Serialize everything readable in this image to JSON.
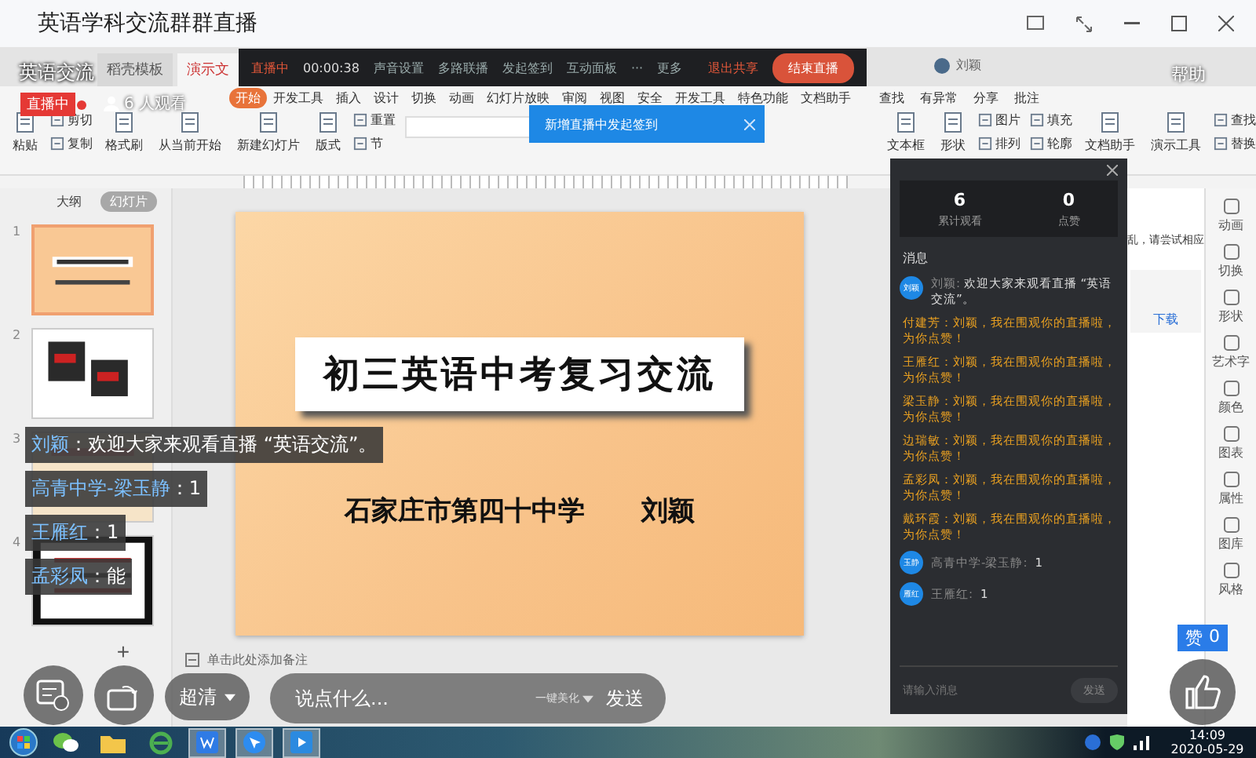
{
  "window": {
    "title": "英语学科交流群群直播"
  },
  "doc_tabs": [
    {
      "label": "稻壳模板",
      "selected": false
    },
    {
      "label": "演示文",
      "selected": true
    }
  ],
  "live_bar": {
    "status": "直播中",
    "timer": "00:00:38",
    "items": [
      "声音设置",
      "多路联播",
      "发起签到",
      "互动面板"
    ],
    "more_glyph": "···",
    "more": "更多",
    "exit_share": "退出共享",
    "end_live": "结束直播"
  },
  "account": {
    "name": "刘颖"
  },
  "help": "帮助",
  "stream_overlay": {
    "title": "英语交流",
    "badge": "直播中",
    "viewers": "6 人观看"
  },
  "menu": {
    "tabs": [
      {
        "label": "开始",
        "selected": true
      },
      {
        "label": "开发工具",
        "selected": false
      },
      {
        "label": "插入",
        "selected": false
      },
      {
        "label": "设计",
        "selected": false
      },
      {
        "label": "切换",
        "selected": false
      },
      {
        "label": "动画",
        "selected": false
      },
      {
        "label": "幻灯片放映",
        "selected": false
      },
      {
        "label": "审阅",
        "selected": false
      },
      {
        "label": "视图",
        "selected": false
      },
      {
        "label": "安全",
        "selected": false
      },
      {
        "label": "开发工具",
        "selected": false
      },
      {
        "label": "特色功能",
        "selected": false
      },
      {
        "label": "文档助手",
        "selected": false
      }
    ],
    "tools": [
      "查找",
      "有异常",
      "分享",
      "批注"
    ]
  },
  "ribbon": {
    "groups": [
      {
        "items": [
          {
            "label": "粘贴",
            "kind": "big"
          }
        ]
      },
      {
        "items": [
          {
            "label": "剪切",
            "kind": "small"
          },
          {
            "label": "复制",
            "kind": "small"
          }
        ]
      },
      {
        "items": [
          {
            "label": "格式刷",
            "kind": "big"
          }
        ]
      },
      {
        "items": [
          {
            "label": "从当前开始",
            "kind": "big"
          }
        ]
      },
      {
        "items": [
          {
            "label": "新建幻灯片",
            "kind": "big"
          }
        ]
      },
      {
        "items": [
          {
            "label": "版式",
            "kind": "big"
          }
        ]
      },
      {
        "items": [
          {
            "label": "重置",
            "kind": "small"
          },
          {
            "label": "节",
            "kind": "small"
          }
        ]
      }
    ],
    "groups_right": [
      {
        "items": [
          {
            "label": "文本框",
            "kind": "big"
          }
        ]
      },
      {
        "items": [
          {
            "label": "形状",
            "kind": "big"
          }
        ]
      },
      {
        "items": [
          {
            "label": "图片",
            "kind": "small"
          },
          {
            "label": "排列",
            "kind": "small"
          }
        ]
      },
      {
        "items": [
          {
            "label": "填充",
            "kind": "small"
          },
          {
            "label": "轮廓",
            "kind": "small"
          }
        ]
      },
      {
        "items": [
          {
            "label": "文档助手",
            "kind": "big"
          }
        ]
      },
      {
        "items": [
          {
            "label": "演示工具",
            "kind": "big"
          }
        ]
      },
      {
        "items": [
          {
            "label": "查找",
            "kind": "small"
          },
          {
            "label": "替换",
            "kind": "small"
          }
        ]
      }
    ]
  },
  "toast": {
    "text": "新增直播中发起签到"
  },
  "slides_pane": {
    "tabs": [
      {
        "label": "大纲",
        "selected": false
      },
      {
        "label": "幻灯片",
        "selected": true
      }
    ],
    "slides": [
      {
        "number": "1",
        "kind": "title",
        "selected": true
      },
      {
        "number": "2",
        "kind": "photos",
        "selected": false
      },
      {
        "number": "3",
        "kind": "plain",
        "selected": false
      },
      {
        "number": "4",
        "kind": "poster",
        "selected": false
      }
    ],
    "add": "+"
  },
  "slide": {
    "title": "初三英语中考复习交流",
    "subtitle": "石家庄市第四十中学",
    "author": "刘颖"
  },
  "notes_placeholder": "单击此处添加备注",
  "danmaku": [
    {
      "name": "刘颖",
      "text": "：欢迎大家来观看直播 “英语交流”。"
    },
    {
      "name": "高青中学-梁玉静",
      "text": "：1"
    },
    {
      "name": "王雁红",
      "text": "：1"
    },
    {
      "name": "孟彩凤",
      "text": "：能"
    }
  ],
  "chat_panel": {
    "stats": [
      {
        "value": "6",
        "label": "累计观看"
      },
      {
        "value": "0",
        "label": "点赞"
      }
    ],
    "heading": "消息",
    "messages": [
      {
        "kind": "host",
        "avatar": "刘颖",
        "name": "刘颖:",
        "text": "欢迎大家来观看直播 “英语交流”。"
      },
      {
        "kind": "like",
        "text": "付建芳：刘颖，我在围观你的直播啦，为你点赞！"
      },
      {
        "kind": "like",
        "text": "王雁红：刘颖，我在围观你的直播啦，为你点赞！"
      },
      {
        "kind": "like",
        "text": "梁玉静：刘颖，我在围观你的直播啦，为你点赞！"
      },
      {
        "kind": "like",
        "text": "边瑞敏：刘颖，我在围观你的直播啦，为你点赞！"
      },
      {
        "kind": "like",
        "text": "孟彩凤：刘颖，我在围观你的直播啦，为你点赞！"
      },
      {
        "kind": "like",
        "text": "戴环霞：刘颖，我在围观你的直播啦，为你点赞！"
      },
      {
        "kind": "comment",
        "avatar": "玉静",
        "name": "高青中学-梁玉静:",
        "text": "1"
      },
      {
        "kind": "comment",
        "avatar": "雁红",
        "name": "王雁红:",
        "text": "1"
      }
    ],
    "input_placeholder": "请输入消息",
    "send": "发送"
  },
  "task_pane": {
    "text": "乱，请尝试相应",
    "link": "下载"
  },
  "right_sidebar": [
    "动画",
    "切换",
    "形状",
    "艺术字",
    "颜色",
    "图表",
    "属性",
    "图库",
    "风格"
  ],
  "live_controls": {
    "quality": "超清",
    "comment_placeholder": "说点什么...",
    "beautify": "一键美化",
    "send": "发送"
  },
  "likes": {
    "label": "赞",
    "count": "0"
  },
  "taskbar": {
    "apps": [
      {
        "kind": "chat",
        "selected": false
      },
      {
        "kind": "folder",
        "selected": false
      },
      {
        "kind": "browser",
        "selected": false
      },
      {
        "kind": "docs",
        "selected": true
      },
      {
        "kind": "arrow",
        "selected": true
      },
      {
        "kind": "video",
        "selected": true
      }
    ],
    "time": "14:09",
    "date": "2020-05-29"
  }
}
